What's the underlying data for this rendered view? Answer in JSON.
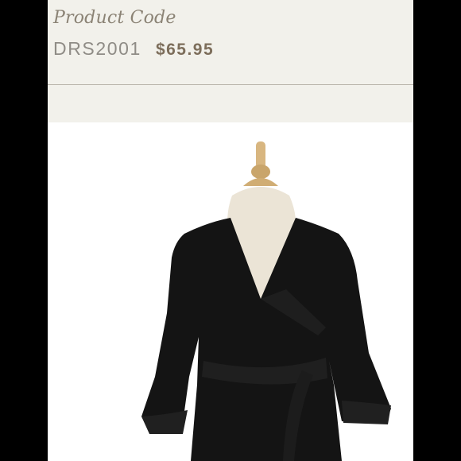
{
  "product": {
    "code_label": "Product Code",
    "code": "DRS2001",
    "price": "$65.95"
  },
  "image": {
    "subject": "product-photo",
    "colors": {
      "dress": "#141414",
      "form": "#ebe4d6",
      "knob": "#d8b680",
      "background": "#ffffff"
    }
  }
}
